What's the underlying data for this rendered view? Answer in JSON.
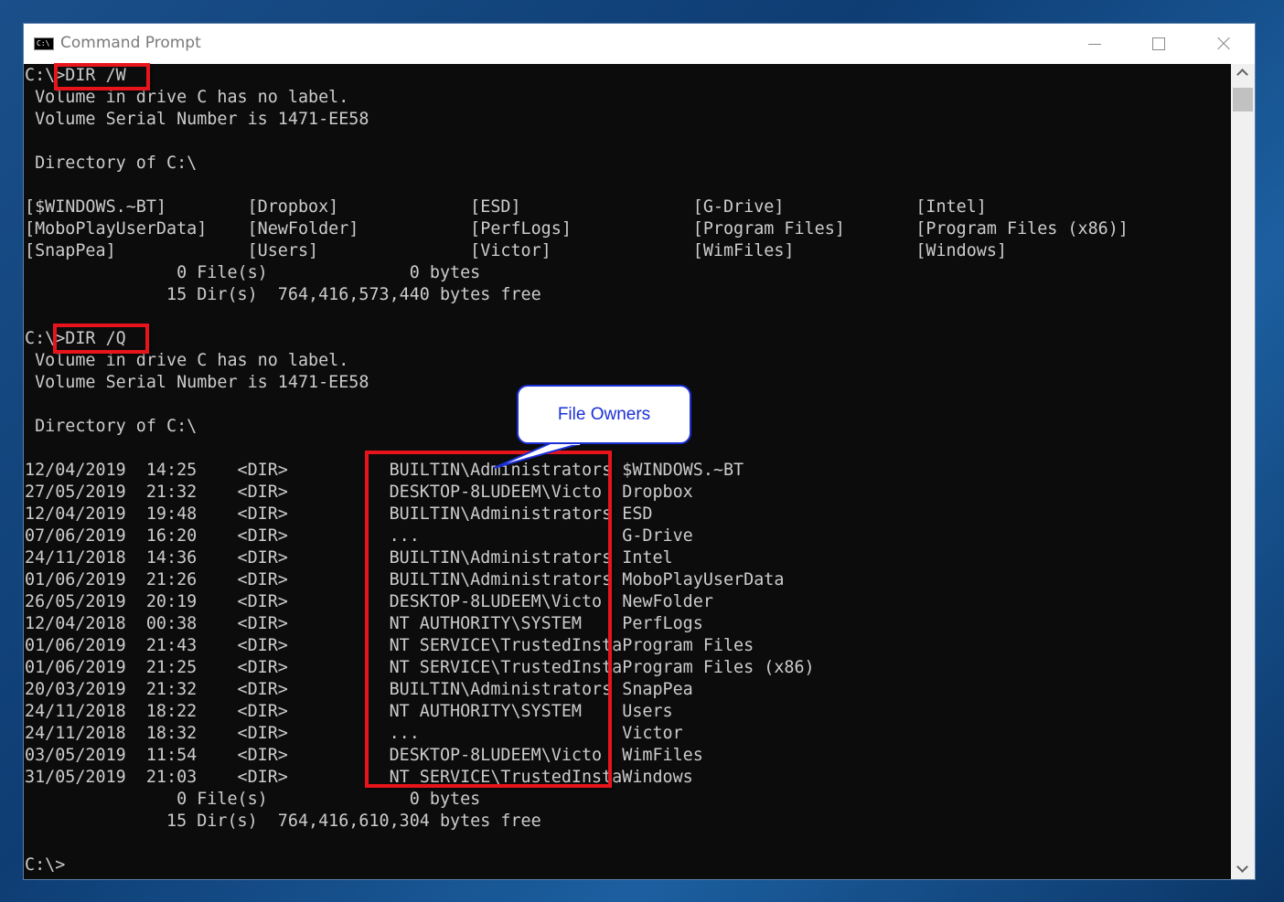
{
  "window": {
    "title": "Command Prompt",
    "icon_label": "C:\\"
  },
  "console": {
    "lines": [
      "C:\\>DIR /W",
      " Volume in drive C has no label.",
      " Volume Serial Number is 1471-EE58",
      "",
      " Directory of C:\\",
      "",
      "[$WINDOWS.~BT]        [Dropbox]             [ESD]                 [G-Drive]             [Intel]",
      "[MoboPlayUserData]    [NewFolder]           [PerfLogs]            [Program Files]       [Program Files (x86)]",
      "[SnapPea]             [Users]               [Victor]              [WimFiles]            [Windows]",
      "               0 File(s)              0 bytes",
      "              15 Dir(s)  764,416,573,440 bytes free",
      "",
      "C:\\>DIR /Q",
      " Volume in drive C has no label.",
      " Volume Serial Number is 1471-EE58",
      "",
      " Directory of C:\\",
      "",
      "12/04/2019  14:25    <DIR>          BUILTIN\\Administrators $WINDOWS.~BT",
      "27/05/2019  21:32    <DIR>          DESKTOP-8LUDEEM\\Victo  Dropbox",
      "12/04/2019  19:48    <DIR>          BUILTIN\\Administrators ESD",
      "07/06/2019  16:20    <DIR>          ...                    G-Drive",
      "24/11/2018  14:36    <DIR>          BUILTIN\\Administrators Intel",
      "01/06/2019  21:26    <DIR>          BUILTIN\\Administrators MoboPlayUserData",
      "26/05/2019  20:19    <DIR>          DESKTOP-8LUDEEM\\Victo  NewFolder",
      "12/04/2018  00:38    <DIR>          NT AUTHORITY\\SYSTEM    PerfLogs",
      "01/06/2019  21:43    <DIR>          NT SERVICE\\TrustedInstaProgram Files",
      "01/06/2019  21:25    <DIR>          NT SERVICE\\TrustedInstaProgram Files (x86)",
      "20/03/2019  21:32    <DIR>          BUILTIN\\Administrators SnapPea",
      "24/11/2018  18:22    <DIR>          NT AUTHORITY\\SYSTEM    Users",
      "24/11/2018  18:32    <DIR>          ...                    Victor",
      "03/05/2019  11:54    <DIR>          DESKTOP-8LUDEEM\\Victo  WimFiles",
      "31/05/2019  21:03    <DIR>          NT SERVICE\\TrustedInstaWindows",
      "               0 File(s)              0 bytes",
      "              15 Dir(s)  764,416,610,304 bytes free",
      "",
      "C:\\>"
    ]
  },
  "annotations": {
    "callout_text": "File Owners",
    "highlight_color": "#e8141b",
    "callout_color": "#1b2fd6"
  }
}
